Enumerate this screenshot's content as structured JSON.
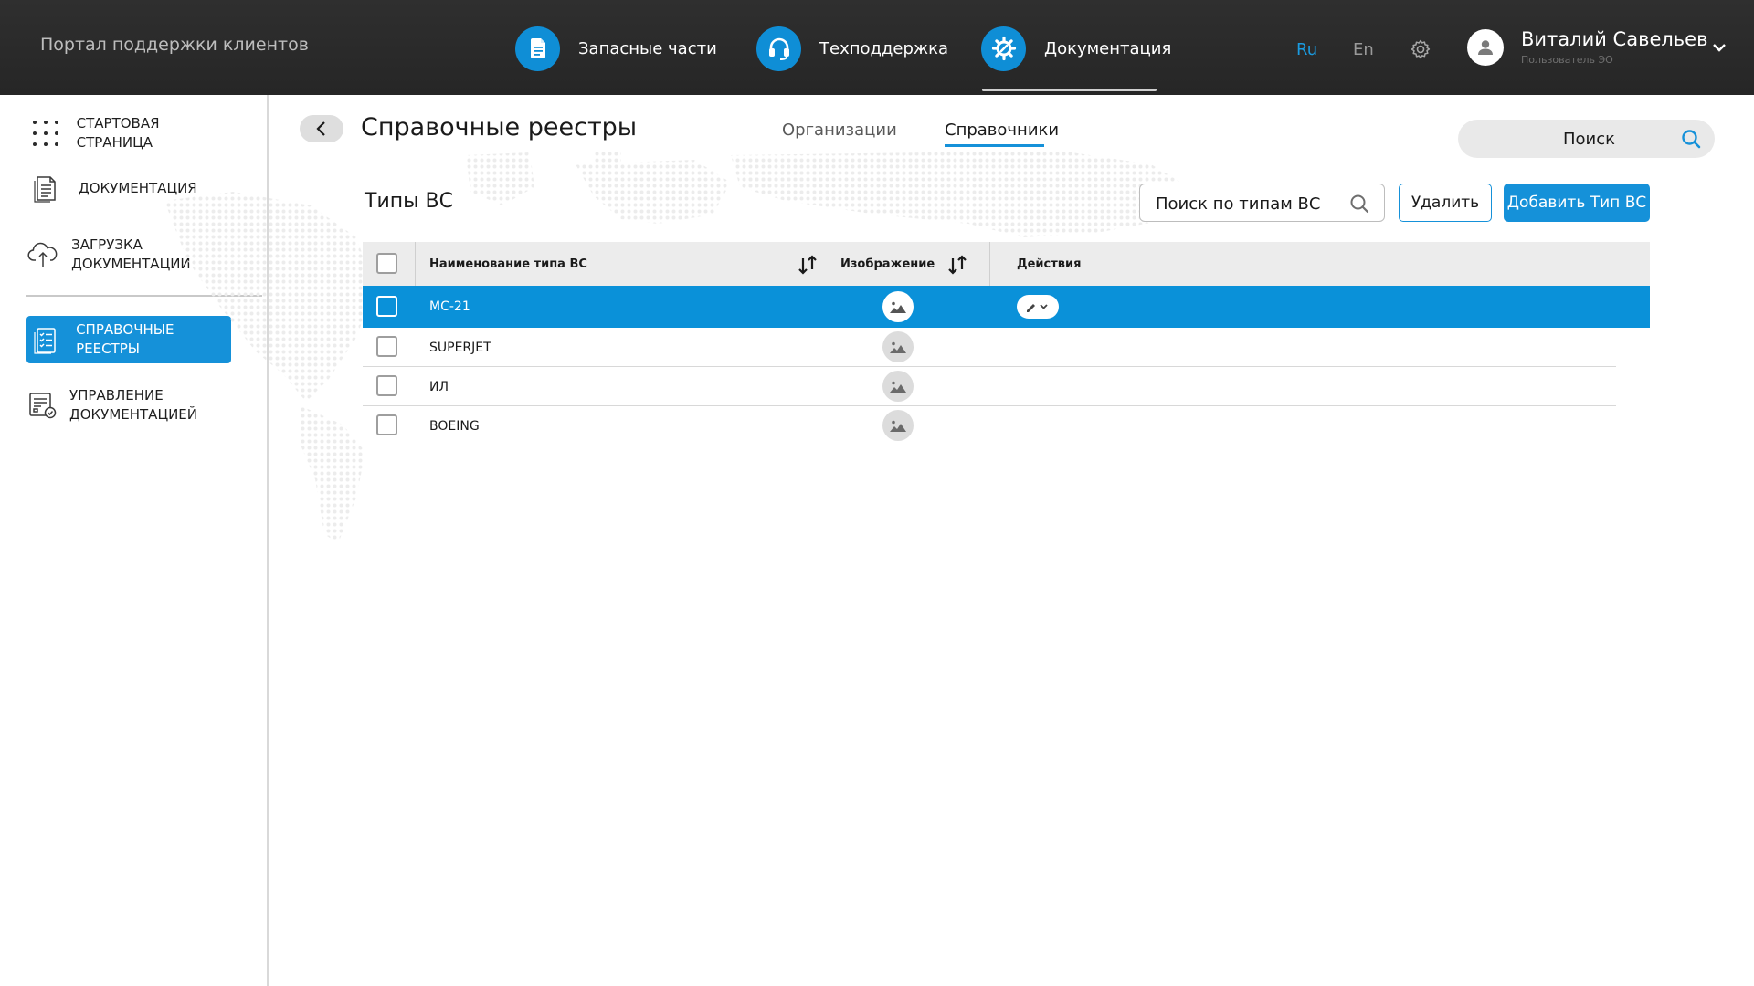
{
  "header": {
    "portal_title": "Портал поддержки клиентов",
    "nav": [
      {
        "label": "Запасные части",
        "icon": "document-icon"
      },
      {
        "label": "Техподдержка",
        "icon": "headset-icon"
      },
      {
        "label": "Документация",
        "icon": "gear-wrench-icon",
        "active": true
      }
    ],
    "languages": {
      "ru": "Ru",
      "en": "En",
      "selected": "Ru"
    },
    "user": {
      "name": "Виталий Савельев",
      "role": "Пользователь ЭО"
    }
  },
  "sidebar": {
    "items": [
      {
        "label": "Стартовая страница",
        "icon": "grid-dots-icon"
      },
      {
        "label": "Документация",
        "icon": "document-list-icon"
      },
      {
        "label": "Загрузка документации",
        "icon": "cloud-upload-icon"
      },
      {
        "label": "Справочные реестры",
        "icon": "checklist-icon",
        "active": true
      },
      {
        "label": "Управление документацией",
        "icon": "document-settings-icon"
      }
    ]
  },
  "page": {
    "title": "Справочные реестры",
    "tabs": [
      {
        "label": "Организации"
      },
      {
        "label": "Справочники",
        "active": true
      }
    ],
    "search_label": "Поиск"
  },
  "section": {
    "title": "Типы ВС",
    "search_label": "Поиск по типам ВС",
    "delete_label": "Удалить",
    "add_label": "Добавить Тип ВС"
  },
  "table": {
    "columns": [
      "Наименование типа ВС",
      "Изображение",
      "Действия"
    ],
    "rows": [
      {
        "name": "МС-21",
        "selected": true
      },
      {
        "name": "SUPERJET",
        "selected": false
      },
      {
        "name": "ИЛ",
        "selected": false
      },
      {
        "name": "BOEING",
        "selected": false
      }
    ]
  },
  "colors": {
    "accent": "#1591d9",
    "topbar": "#2b2b2b",
    "selected_row": "#0a91d9",
    "lang_active": "#1a9be0"
  }
}
